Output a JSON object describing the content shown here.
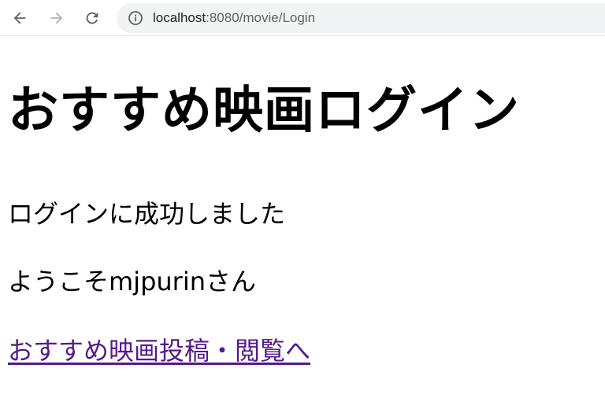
{
  "browser": {
    "url_host": "localhost",
    "url_rest": ":8080/movie/Login"
  },
  "page": {
    "title": "おすすめ映画ログイン",
    "success_message": "ログインに成功しました",
    "welcome_message": "ようこそmjpurinさん",
    "link_label": "おすすめ映画投稿・閲覧へ"
  },
  "colors": {
    "link_visited": "#551a8b",
    "omnibox_bg": "#f1f3f4",
    "icon_gray": "#5f6368"
  }
}
